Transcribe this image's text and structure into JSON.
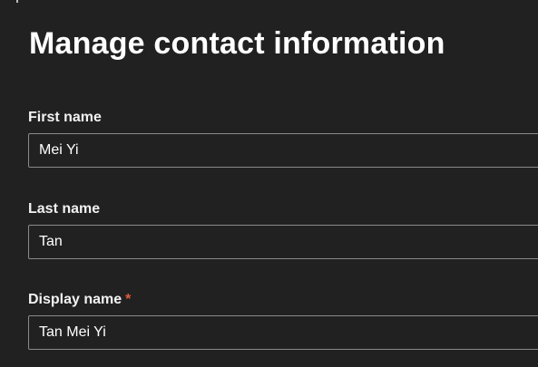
{
  "form": {
    "title": "Manage contact information",
    "fields": [
      {
        "label": "First name",
        "value": "Mei Yi",
        "required": false
      },
      {
        "label": "Last name",
        "value": "Tan",
        "required": false
      },
      {
        "label": "Display name",
        "value": "Tan Mei Yi",
        "required": true,
        "required_marker": "*"
      }
    ]
  },
  "colors": {
    "background": "#212121",
    "text": "#ffffff",
    "input_border": "#8a8a8a",
    "required_marker": "#e05a3a"
  }
}
